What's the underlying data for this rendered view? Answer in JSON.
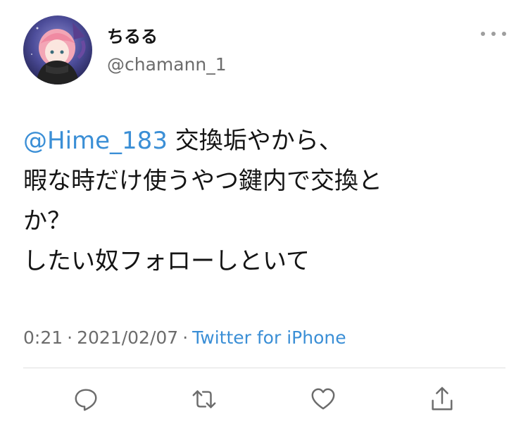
{
  "tweet": {
    "display_name": "ちるる",
    "handle": "@chamann_1",
    "mention": "@Hime_183",
    "text_lines": [
      "交換垢やから、",
      "暇な時だけ使うやつ鍵内で交換と",
      "か？",
      "したい奴フォローしといて"
    ],
    "time": "0:21",
    "separator": "·",
    "date": "2021/02/07",
    "source": "Twitter for iPhone"
  },
  "actions": {
    "reply_icon": "reply-icon",
    "retweet_icon": "retweet-icon",
    "like_icon": "heart-icon",
    "share_icon": "share-icon"
  },
  "colors": {
    "link": "#3b8fd6",
    "secondary_text": "#6c6c6c",
    "icon": "#6c6c6c"
  }
}
